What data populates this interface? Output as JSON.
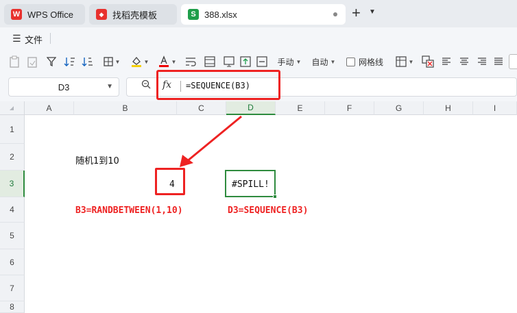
{
  "tabs": [
    {
      "label": "WPS Office",
      "icon": "W"
    },
    {
      "label": "找稻壳模板",
      "icon": "稻"
    },
    {
      "label": "388.xlsx",
      "icon": "S"
    }
  ],
  "menu": {
    "file_label": "文件"
  },
  "toolbar": {
    "manual_label": "手动",
    "auto_label": "自动",
    "gridlines_label": "网格线"
  },
  "formula": {
    "cell_ref": "D3",
    "fx_label": "fx",
    "text": "=SEQUENCE(B3)"
  },
  "columns": [
    "A",
    "B",
    "C",
    "D",
    "E",
    "F",
    "G",
    "H",
    "I"
  ],
  "rows": [
    "1",
    "2",
    "3",
    "4",
    "5",
    "6",
    "7",
    "8"
  ],
  "cells": {
    "B2": "随机1到10",
    "C3": "4",
    "D3": "#SPILL!",
    "B4": "B3=RANDBETWEEN(1,10)",
    "D4": "D3=SEQUENCE(B3)"
  },
  "colors": {
    "accent_green": "#2e8b3e",
    "annotation_red": "#e22222",
    "wps_red": "#e8312e",
    "sheet_green": "#1e9e4a"
  }
}
